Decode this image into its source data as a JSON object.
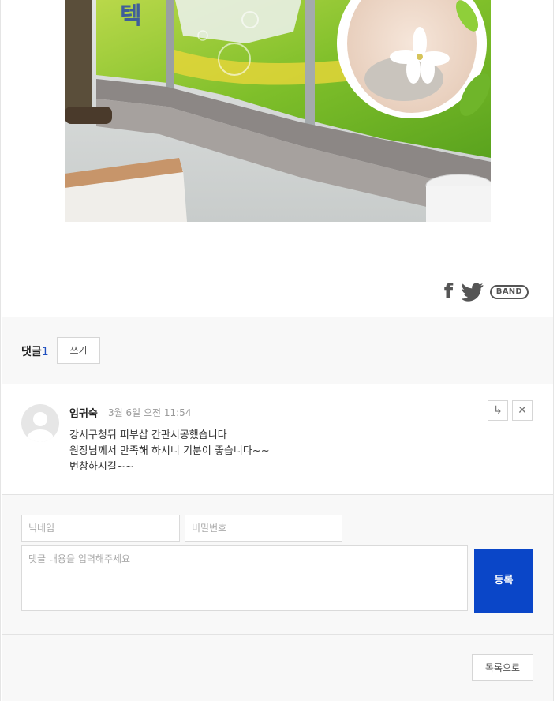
{
  "share": {
    "facebook_glyph": "f",
    "band_label": "BAND"
  },
  "comments": {
    "title": "댓글",
    "count": "1",
    "write_label": "쓰기",
    "items": [
      {
        "author": "임귀숙",
        "date": "3월 6일 오전 11:54",
        "lines": [
          "강서구청뒤  피부샵 간판시공했습니다",
          "원장님께서 만족해 하시니 기분이 좋습니다~~",
          "번창하시길~~"
        ],
        "reply_glyph": "↳",
        "delete_glyph": "✕"
      }
    ]
  },
  "form": {
    "nickname_placeholder": "닉네임",
    "password_placeholder": "비밀번호",
    "content_placeholder": "댓글 내용을 입력해주세요",
    "submit_label": "등록"
  },
  "footer": {
    "list_label": "목록으로"
  },
  "colors": {
    "accent": "#0a46c8",
    "count": "#1f4fbf",
    "band_bg": "#f8f8f8"
  }
}
